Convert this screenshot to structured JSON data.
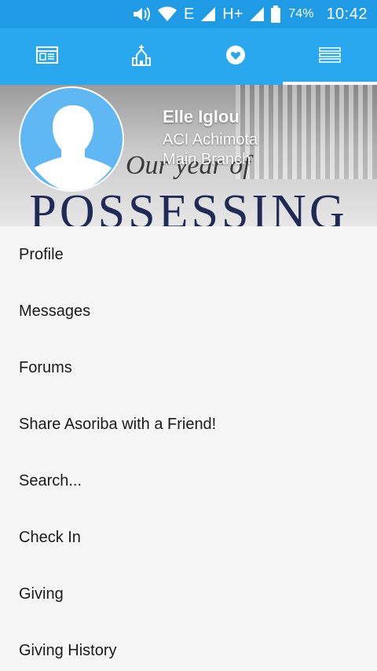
{
  "status_bar": {
    "network_type": "E",
    "network_type_2": "H+",
    "battery": "74%",
    "time": "10:42"
  },
  "tabs": [
    {
      "icon": "news-icon"
    },
    {
      "icon": "church-icon"
    },
    {
      "icon": "heart-icon"
    },
    {
      "icon": "menu-icon",
      "active": true
    }
  ],
  "header": {
    "banner_text": "POSSESSING",
    "script_text": "Our year of",
    "user": {
      "name": "Elle Iglou",
      "church": "ACI Achimota",
      "branch": "Main Branch"
    }
  },
  "menu": [
    "Profile",
    "Messages",
    "Forums",
    "Share Asoriba with a Friend!",
    "Search...",
    "Check In",
    "Giving",
    "Giving History"
  ],
  "colors": {
    "status_bar": "#1e9be4",
    "tab_bar": "#2aa8ef",
    "avatar": "#5fb8f3"
  }
}
